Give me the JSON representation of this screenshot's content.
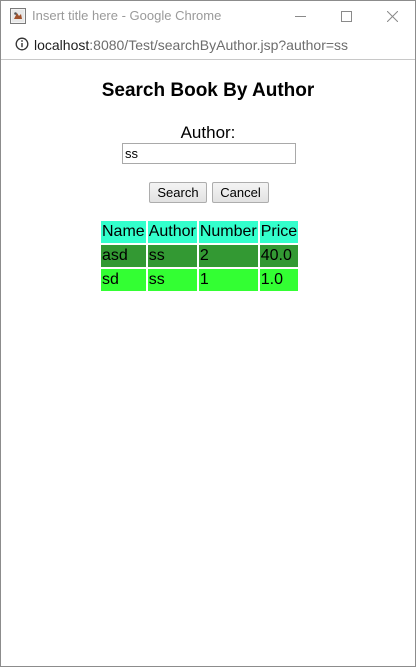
{
  "window": {
    "title": "Insert title here - Google Chrome"
  },
  "address_bar": {
    "host": "localhost",
    "path": ":8080/Test/searchByAuthor.jsp?author=ss"
  },
  "page": {
    "heading": "Search Book By Author",
    "author_label": "Author:",
    "author_value": "ss",
    "search_button": "Search",
    "cancel_button": "Cancel"
  },
  "table": {
    "headers": [
      "Name",
      "Author",
      "Number",
      "Price"
    ],
    "rows": [
      [
        "asd",
        "ss",
        "2",
        "40.0"
      ],
      [
        "sd",
        "ss",
        "1",
        "1.0"
      ]
    ]
  },
  "colors": {
    "header_bg": "#33ffcc",
    "row_dark_bg": "#339933",
    "row_light_bg": "#33ff33"
  }
}
